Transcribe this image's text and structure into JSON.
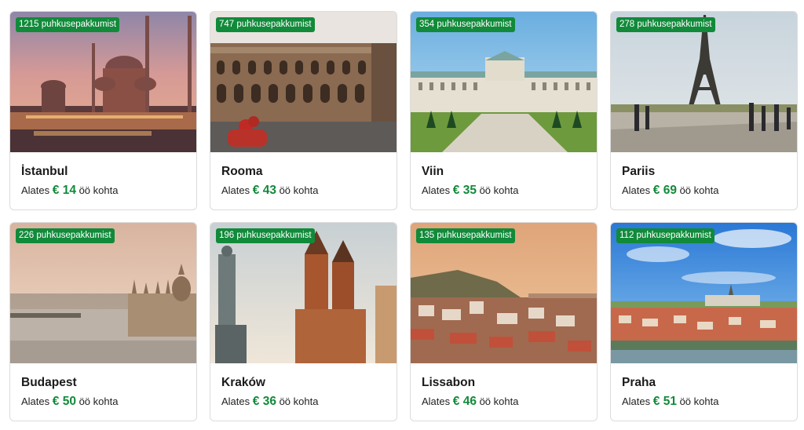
{
  "cards": [
    {
      "city": "İstanbul",
      "count_label": "1215 puhkusepakkumist",
      "prefix": "Alates",
      "amount": "€ 14",
      "suffix": "öö kohta",
      "image": "istanbul-mosque-photo"
    },
    {
      "city": "Rooma",
      "count_label": "747 puhkusepakkumist",
      "prefix": "Alates",
      "amount": "€ 43",
      "suffix": "öö kohta",
      "image": "rome-colosseum-photo"
    },
    {
      "city": "Viin",
      "count_label": "354 puhkusepakkumist",
      "prefix": "Alates",
      "amount": "€ 35",
      "suffix": "öö kohta",
      "image": "vienna-belvedere-photo"
    },
    {
      "city": "Pariis",
      "count_label": "278 puhkusepakkumist",
      "prefix": "Alates",
      "amount": "€ 69",
      "suffix": "öö kohta",
      "image": "paris-eiffel-tower-photo"
    },
    {
      "city": "Budapest",
      "count_label": "226 puhkusepakkumist",
      "prefix": "Alates",
      "amount": "€ 50",
      "suffix": "öö kohta",
      "image": "budapest-parliament-photo"
    },
    {
      "city": "Kraków",
      "count_label": "196 puhkusepakkumist",
      "prefix": "Alates",
      "amount": "€ 36",
      "suffix": "öö kohta",
      "image": "krakow-basilica-photo"
    },
    {
      "city": "Lissabon",
      "count_label": "135 puhkusepakkumist",
      "prefix": "Alates",
      "amount": "€ 46",
      "suffix": "öö kohta",
      "image": "lisbon-cityscape-photo"
    },
    {
      "city": "Praha",
      "count_label": "112 puhkusepakkumist",
      "prefix": "Alates",
      "amount": "€ 51",
      "suffix": "öö kohta",
      "image": "prague-castle-photo"
    }
  ],
  "colors": {
    "accent": "#118a3a",
    "border": "#dcdcdc"
  }
}
